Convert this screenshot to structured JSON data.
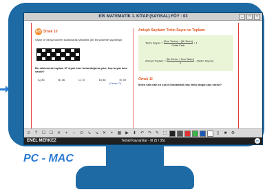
{
  "window": {
    "title": "EİS MATEMATİK 1. KİTAP (SAYISAL) FÖY : 03",
    "buttons": [
      "_",
      "□",
      "×"
    ]
  },
  "page": {
    "left": {
      "q_label": "Örnek 10",
      "q_text": "Siyah ve beyaz kareler kullanılarak şekildeki gibi bir süsleme yapılmıştır.",
      "q_text2": "Bu süslemede toplam 37 siyah kare bulunduğuna göre, kaç beyaz kare vardır?",
      "options": [
        "A) 35",
        "B) 36",
        "C) 37",
        "D) 38",
        "E) 39"
      ],
      "cevap": "(Cevap: D)"
    },
    "right": {
      "formula_title": "Ardışık Sayıların Terim Sayısı ve Toplamı",
      "f1_left": "Terim Sayısı =",
      "f1_num": "(Son Terim) – (İlk Terim)",
      "f1_den": "Ortak Fark",
      "f1_tail": "+ 1",
      "f2_left": "Ardışık Toplam =",
      "f2_num": "(İlk Terim + Son Terim)",
      "f2_den": "2",
      "f2_tail": "· (Terim Sayısı)",
      "q2_label": "Örnek 11",
      "q2_text": "8'den kalı olan en çok iki basamaklı kaç farklı doğal sayı vardır?"
    }
  },
  "toolbar": {
    "tools": [
      "≡",
      "?",
      "☐",
      "☐",
      "✕",
      "+",
      "–",
      "⬭",
      "↘",
      "↘",
      "✕",
      "+",
      "▦",
      "▶",
      "⬇",
      "↶",
      "↷",
      "✎",
      "⬚",
      "●",
      "●",
      "●",
      "●",
      "●",
      "●",
      "▯",
      "■",
      "⚙"
    ],
    "swatches": [
      "#222222",
      "#555555",
      "#e23232",
      "#3ab54a",
      "#1e5ab5",
      "#ffffff"
    ]
  },
  "status": {
    "left": "ENEL MERKEZ",
    "center": "Temel Kavramlar - III (5 / 35)",
    "logo": "EİS"
  },
  "caption": "PC - MAC",
  "colors": {
    "monitor": "#1d6aa4",
    "accent": "#e05522",
    "caption": "#2a7bd4"
  }
}
